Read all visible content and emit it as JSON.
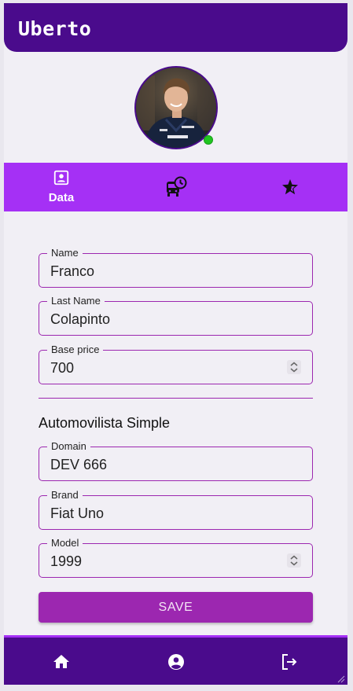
{
  "app": {
    "title": "Uberto"
  },
  "profile": {
    "avatar_icon": "driver-photo",
    "status": "online",
    "status_color": "#21c521"
  },
  "tabs": [
    {
      "label": "Data",
      "icon": "account-box-icon",
      "active": true
    },
    {
      "label": "",
      "icon": "bus-clock-icon",
      "active": false
    },
    {
      "label": "",
      "icon": "star-rating-icon",
      "active": false
    }
  ],
  "form": {
    "name": {
      "label": "Name",
      "value": "Franco"
    },
    "last_name": {
      "label": "Last Name",
      "value": "Colapinto"
    },
    "base_price": {
      "label": "Base price",
      "value": "700"
    },
    "section_title": "Automovilista Simple",
    "domain": {
      "label": "Domain",
      "value": "DEV 666"
    },
    "brand": {
      "label": "Brand",
      "value": "Fiat Uno"
    },
    "model": {
      "label": "Model",
      "value": "1999"
    },
    "save_label": "SAVE"
  },
  "bottom_nav": [
    {
      "icon": "home-icon"
    },
    {
      "icon": "account-circle-icon"
    },
    {
      "icon": "logout-icon"
    }
  ],
  "colors": {
    "header": "#4a0b8c",
    "tabbar": "#a530f5",
    "accent": "#9c27b0",
    "background": "#f1eff5"
  }
}
